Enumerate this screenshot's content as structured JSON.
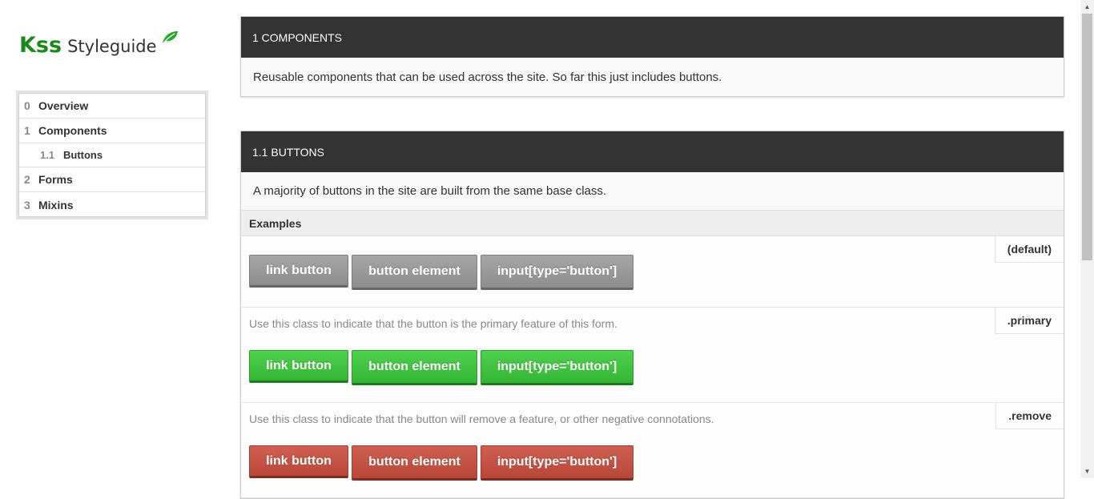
{
  "logo": {
    "brand": "Kss",
    "product": "Styleguide",
    "icon": "leaf-icon",
    "brand_color": "#1a8a1a"
  },
  "nav": {
    "items": [
      {
        "num": "0",
        "label": "Overview"
      },
      {
        "num": "1",
        "label": "Components"
      },
      {
        "num": "1.1",
        "label": "Buttons"
      },
      {
        "num": "2",
        "label": "Forms"
      },
      {
        "num": "3",
        "label": "Mixins"
      }
    ]
  },
  "sections": [
    {
      "title": "1 COMPONENTS",
      "description": "Reusable components that can be used across the site. So far this just includes buttons."
    },
    {
      "title": "1.1 BUTTONS",
      "description": "A majority of buttons in the site are built from the same base class.",
      "examples_label": "Examples",
      "examples": [
        {
          "modifier": "(default)",
          "description": "",
          "color": "#999999",
          "buttons": [
            "link button",
            "button element",
            "input[type='button']"
          ]
        },
        {
          "modifier": ".primary",
          "description": "Use this class to indicate that the button is the primary feature of this form.",
          "color": "#3fbf3f",
          "buttons": [
            "link button",
            "button element",
            "input[type='button']"
          ]
        },
        {
          "modifier": ".remove",
          "description": "Use this class to indicate that the button will remove a feature, or other negative connotations.",
          "color": "#c35244",
          "buttons": [
            "link button",
            "button element",
            "input[type='button']"
          ]
        }
      ]
    }
  ],
  "header_bg": "#333333"
}
